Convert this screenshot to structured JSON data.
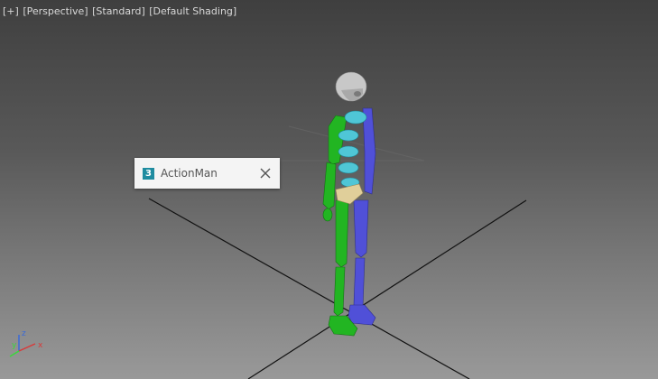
{
  "viewport": {
    "labels": [
      "[+]",
      "[Perspective]",
      "[Standard]",
      "[Default Shading]"
    ]
  },
  "popup": {
    "app_icon_text": "3",
    "title": "ActionMan",
    "close_icon": "close-icon"
  },
  "gizmo": {
    "x_label": "x",
    "y_label": "y",
    "z_label": "z"
  },
  "colors": {
    "left_limbs": "#22b522",
    "right_limbs": "#5050d8",
    "spine": "#4fc6d6",
    "pelvis": "#e0cf9a",
    "head": "#c8c8c8",
    "grid_line": "#111111"
  }
}
